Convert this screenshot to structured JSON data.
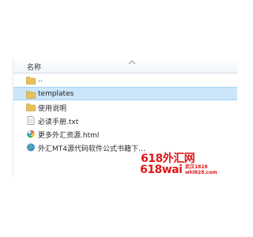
{
  "header": {
    "name_column": "名称"
  },
  "files": [
    {
      "name": "..",
      "icon": "folder-icon"
    },
    {
      "name": "templates",
      "icon": "folder-icon",
      "selected": true
    },
    {
      "name": "使用说明",
      "icon": "folder-icon"
    },
    {
      "name": "必读手册.txt",
      "icon": "text-file-icon"
    },
    {
      "name": "更多外汇资源.html",
      "icon": "html-file-icon"
    },
    {
      "name": "外汇MT4源代码软件公式书籍下…",
      "icon": "web-link-icon"
    }
  ],
  "watermark": {
    "line1": "618外汇网",
    "line2": "618wai",
    "line3": "武汉1828",
    "line4": "whl828.com"
  },
  "colors": {
    "selection": "#cbe6fb",
    "folder": "#e8c15a",
    "watermark": "#e01818"
  }
}
